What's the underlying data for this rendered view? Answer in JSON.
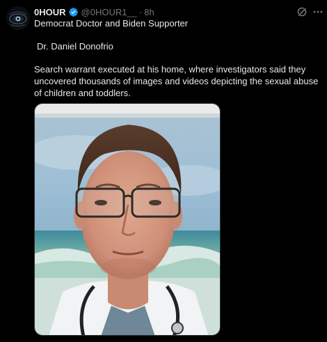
{
  "post": {
    "author": {
      "display_name": "0HOUR",
      "handle": "@0HOUR1__",
      "separator": "·",
      "time": "8h",
      "verified": true,
      "verified_color": "#1d9bf0"
    },
    "text": {
      "line1": "Democrat Doctor and Biden Supporter",
      "line2": "Dr. Daniel Donofrio",
      "line3": "Search warrant executed at his home, where investigators said they uncovered thousands of images and videos depicting the sexual abuse of children and toddlers."
    },
    "media": {
      "type": "photo",
      "description_icon": "photo-portrait"
    },
    "icons": {
      "grok": "grok-icon",
      "more": "more-horizontal-icon",
      "verified": "verified-badge-icon"
    }
  },
  "colors": {
    "background": "#000000",
    "text_primary": "#e7e9ea",
    "text_secondary": "#71767b",
    "border": "#2f3336"
  }
}
